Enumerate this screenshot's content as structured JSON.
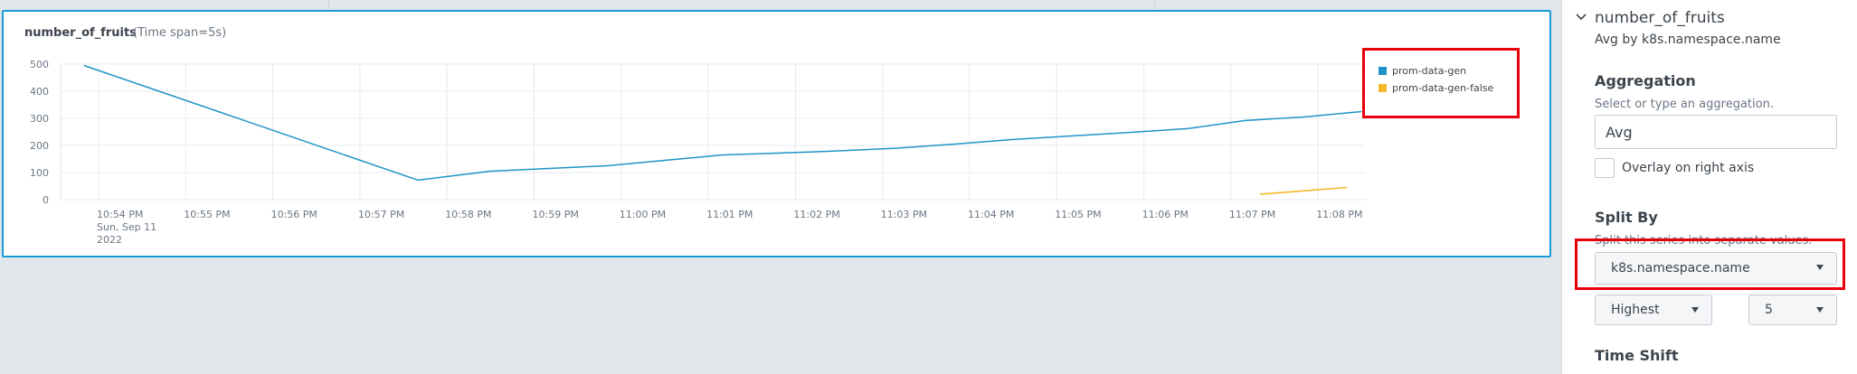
{
  "panel": {
    "title": "number_of_fruits",
    "time_span": "(Time span=5s)"
  },
  "chart_data": {
    "type": "line",
    "ylim": [
      0,
      500
    ],
    "y_ticks": [
      "500",
      "400",
      "300",
      "200",
      "100",
      "0"
    ],
    "x_ticks": [
      "10:54 PM",
      "10:55 PM",
      "10:56 PM",
      "10:57 PM",
      "10:58 PM",
      "10:59 PM",
      "11:00 PM",
      "11:01 PM",
      "11:02 PM",
      "11:03 PM",
      "11:04 PM",
      "11:05 PM",
      "11:06 PM",
      "11:07 PM",
      "11:08 PM"
    ],
    "x_first_sublabel": [
      "Sun, Sep 11",
      "2022"
    ],
    "series": [
      {
        "name": "prom-data-gen",
        "color": "#1e93c6",
        "x": [
          "10:53:50 PM",
          "10:57:40 PM",
          "10:58:30 PM",
          "10:59:10 PM",
          "10:59:50 PM",
          "11:00:30 PM",
          "11:01:10 PM",
          "11:01:50 PM",
          "11:02:30 PM",
          "11:03:10 PM",
          "11:03:50 PM",
          "11:04:30 PM",
          "11:05:10 PM",
          "11:05:50 PM",
          "11:06:30 PM",
          "11:07:10 PM",
          "11:07:50 PM",
          "11:08:30 PM"
        ],
        "values": [
          495,
          72,
          105,
          115,
          125,
          145,
          165,
          172,
          180,
          190,
          205,
          222,
          235,
          248,
          262,
          292,
          305,
          325
        ]
      },
      {
        "name": "prom-data-gen-false",
        "color": "#f2b827",
        "x": [
          "11:07:20 PM",
          "11:08:20 PM"
        ],
        "values": [
          20,
          45
        ]
      }
    ]
  },
  "editor": {
    "metric": "number_of_fruits",
    "subtitle": "Avg by k8s.namespace.name",
    "aggregation_heading": "Aggregation",
    "aggregation_help": "Select or type an aggregation.",
    "aggregation_value": "Avg",
    "overlay_label": "Overlay on right axis",
    "split_heading": "Split By",
    "split_help": "Split this series into separate values.",
    "split_value": "k8s.namespace.name",
    "limit_type": "Highest",
    "limit_count": "5",
    "time_shift_heading": "Time Shift"
  },
  "colors": {
    "accent_blue": "#1a9bd7",
    "highlight_red": "#e8000b"
  }
}
